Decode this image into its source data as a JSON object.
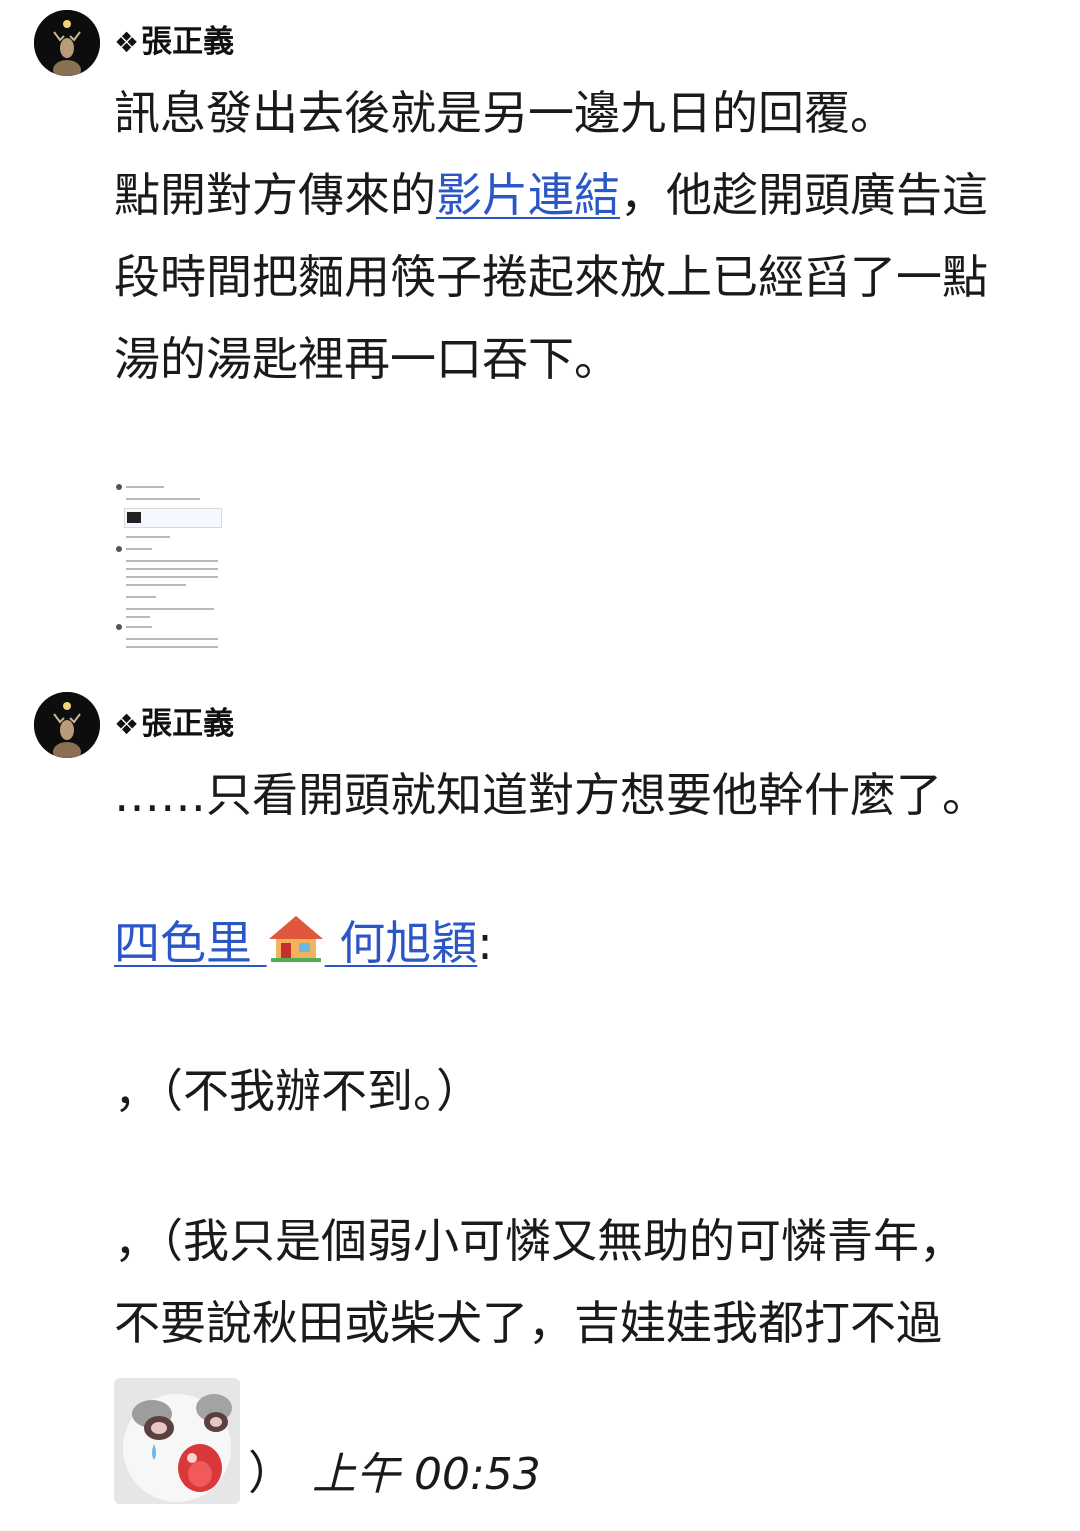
{
  "messages": [
    {
      "sender_prefix": "❖",
      "sender_name": "張正義",
      "line1": "訊息發出去後就是另一邊九日的回覆。",
      "line2_before_link": "點開對方傳來的",
      "link_text": "影片連結",
      "line2_after_link": "，他趁開頭廣告這",
      "line3": "段時間把麵用筷子捲起來放上已經舀了一點",
      "line4": "湯的湯匙裡再一口吞下。"
    },
    {
      "sender_prefix": "❖",
      "sender_name": "張正義",
      "line1": "……只看開頭就知道對方想要他幹什麼了。",
      "reply_name_part1": "四色里",
      "reply_house_icon": "house-emoji",
      "reply_name_part2": "何旭穎",
      "reply_colon": ":",
      "quote1": "，（不我辦不到。）",
      "quote2_line1": "，（我只是個弱小可憐又無助的可憐青年，",
      "quote2_line2": "不要說秋田或柴犬了，吉娃娃我都打不過",
      "quote2_close": "）",
      "timestamp": "上午 00:53"
    }
  ],
  "colors": {
    "link": "#2a56c6",
    "text": "#1a1a1a",
    "background": "#ffffff"
  }
}
